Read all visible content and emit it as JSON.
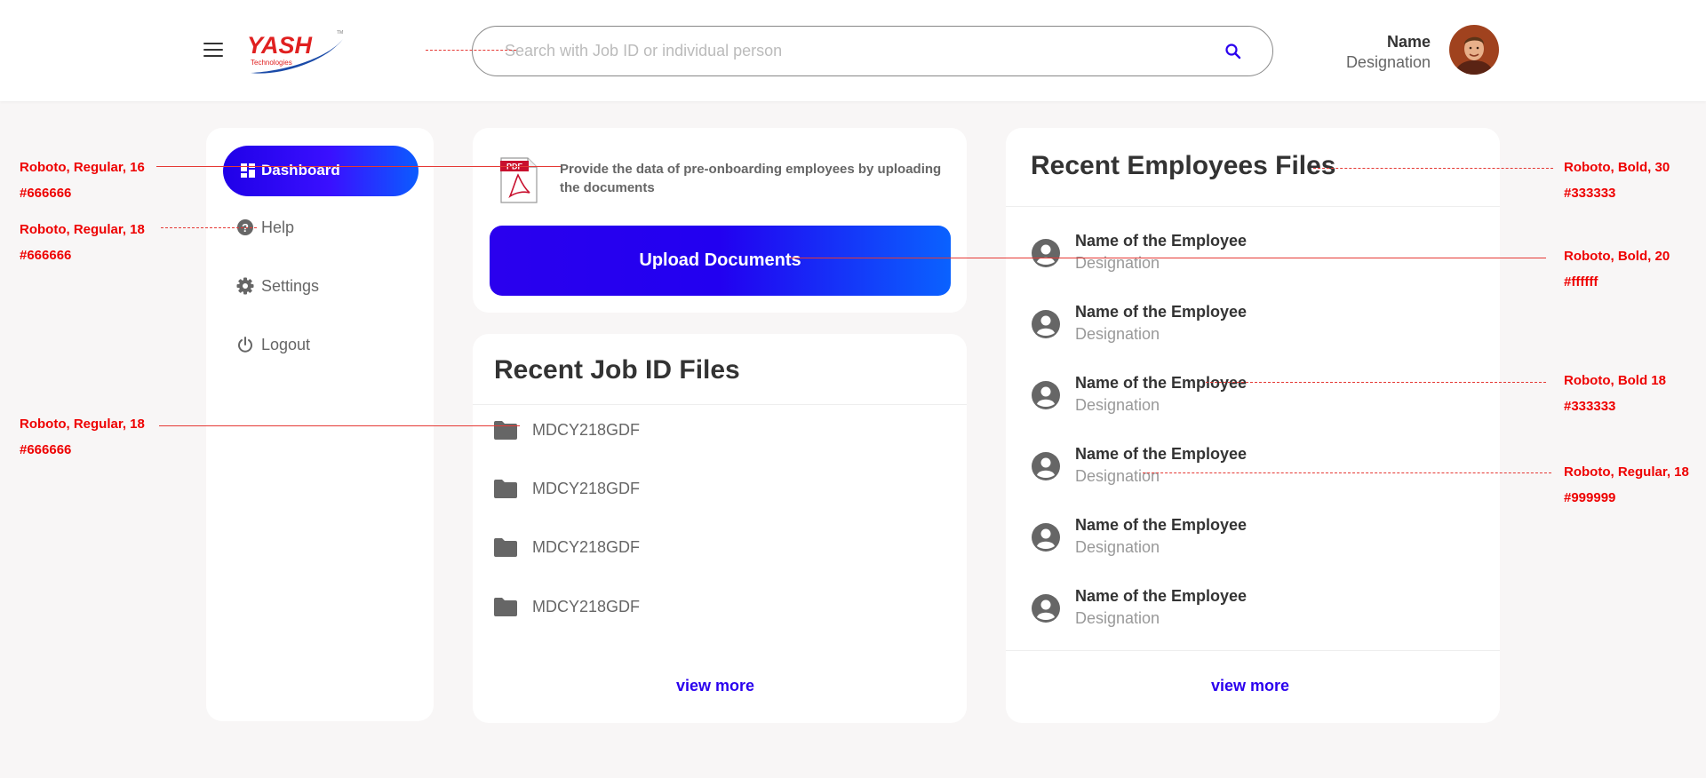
{
  "header": {
    "logo": {
      "text": "YASH",
      "sub": "Technologies",
      "tm": "TM"
    },
    "search": {
      "placeholder": "Search with Job ID or individual person"
    },
    "user": {
      "name": "Name",
      "designation": "Designation"
    }
  },
  "sidebar": {
    "items": [
      {
        "label": "Dashboard",
        "icon": "dashboard-icon",
        "active": true
      },
      {
        "label": "Help",
        "icon": "help-icon"
      },
      {
        "label": "Settings",
        "icon": "settings-icon"
      },
      {
        "label": "Logout",
        "icon": "logout-icon"
      }
    ]
  },
  "upload": {
    "text": "Provide the data of pre-onboarding employees by uploading the documents",
    "pdf_label": "PDF",
    "button": "Upload Documents"
  },
  "jobs": {
    "title": "Recent Job ID Files",
    "items": [
      "MDCY218GDF",
      "MDCY218GDF",
      "MDCY218GDF",
      "MDCY218GDF"
    ],
    "view_more": "view more"
  },
  "employees": {
    "title": "Recent Employees Files",
    "items": [
      {
        "name": "Name of the Employee",
        "designation": "Designation"
      },
      {
        "name": "Name of the Employee",
        "designation": "Designation"
      },
      {
        "name": "Name of the Employee",
        "designation": "Designation"
      },
      {
        "name": "Name of the Employee",
        "designation": "Designation"
      },
      {
        "name": "Name of the Employee",
        "designation": "Designation"
      },
      {
        "name": "Name of the Employee",
        "designation": "Designation"
      }
    ],
    "view_more": "view more"
  },
  "annotations": {
    "left": [
      {
        "font": "Roboto, Regular, 16",
        "color": "#666666"
      },
      {
        "font": "Roboto, Regular, 18",
        "color": "#666666"
      },
      {
        "font": "Roboto, Regular, 18",
        "color": "#666666"
      }
    ],
    "right": [
      {
        "font": "Roboto, Bold, 30",
        "color": "#333333"
      },
      {
        "font": "Roboto, Bold, 20",
        "color": "#ffffff"
      },
      {
        "font": "Roboto, Bold 18",
        "color": "#333333"
      },
      {
        "font": "Roboto, Regular, 18",
        "color": "#999999"
      }
    ]
  },
  "colors": {
    "accent": "#2a00ee",
    "accent_light": "#0a62ff",
    "annotation": "#e00000",
    "background": "#f8f6f6"
  }
}
